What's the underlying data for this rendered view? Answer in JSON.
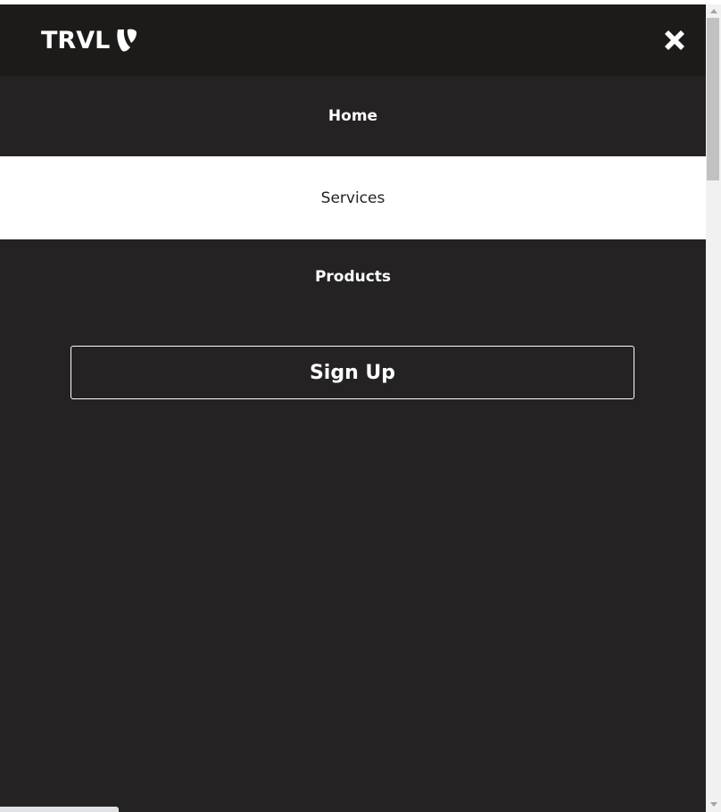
{
  "header": {
    "brand": "TRVL",
    "brand_icon": "typo3-logo-icon",
    "close_icon": "close-icon"
  },
  "nav": {
    "items": [
      {
        "label": "Home",
        "active": false
      },
      {
        "label": "Services",
        "active": true
      },
      {
        "label": "Products",
        "active": false
      }
    ]
  },
  "cta": {
    "label": "Sign Up"
  },
  "colors": {
    "panel_bg": "#242223",
    "header_bg": "#1c1b1a",
    "active_item_bg": "#ffffff",
    "text_light": "#ffffff",
    "text_dark": "#222222"
  }
}
